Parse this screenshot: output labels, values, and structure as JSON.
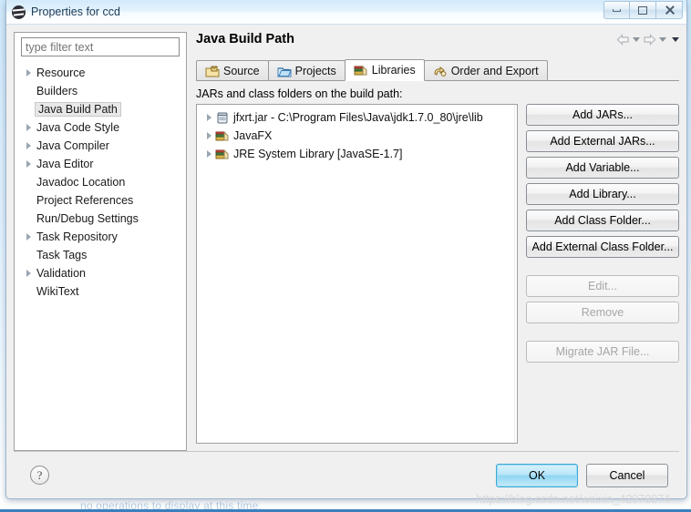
{
  "window": {
    "title": "Properties for ccd",
    "app_icon": "eclipse-icon",
    "controls": {
      "minimize": "minimize-icon",
      "maximize": "maximize-icon",
      "close": "close-icon"
    }
  },
  "sidebar": {
    "filter": {
      "value": "",
      "placeholder": "type filter text"
    },
    "items": [
      {
        "label": "Resource",
        "expandable": true,
        "selected": false
      },
      {
        "label": "Builders",
        "expandable": false,
        "selected": false
      },
      {
        "label": "Java Build Path",
        "expandable": false,
        "selected": true
      },
      {
        "label": "Java Code Style",
        "expandable": true,
        "selected": false
      },
      {
        "label": "Java Compiler",
        "expandable": true,
        "selected": false
      },
      {
        "label": "Java Editor",
        "expandable": true,
        "selected": false
      },
      {
        "label": "Javadoc Location",
        "expandable": false,
        "selected": false
      },
      {
        "label": "Project References",
        "expandable": false,
        "selected": false
      },
      {
        "label": "Run/Debug Settings",
        "expandable": false,
        "selected": false
      },
      {
        "label": "Task Repository",
        "expandable": true,
        "selected": false
      },
      {
        "label": "Task Tags",
        "expandable": false,
        "selected": false
      },
      {
        "label": "Validation",
        "expandable": true,
        "selected": false
      },
      {
        "label": "WikiText",
        "expandable": false,
        "selected": false
      }
    ]
  },
  "page": {
    "title": "Java Build Path",
    "nav": {
      "back": "back-arrow-icon",
      "back_menu": "chevron-down-icon",
      "forward": "forward-arrow-icon",
      "forward_menu": "chevron-down-icon",
      "view_menu": "view-menu-icon"
    },
    "tabs": [
      {
        "label": "Source",
        "icon": "source-folder-icon",
        "active": false
      },
      {
        "label": "Projects",
        "icon": "projects-folder-icon",
        "active": false
      },
      {
        "label": "Libraries",
        "icon": "library-books-icon",
        "active": true
      },
      {
        "label": "Order and Export",
        "icon": "order-export-icon",
        "active": false
      }
    ],
    "list_caption": "JARs and class folders on the build path:",
    "entries": [
      {
        "label": "jfxrt.jar - C:\\Program Files\\Java\\jdk1.7.0_80\\jre\\lib",
        "icon": "jar-icon",
        "expandable": true
      },
      {
        "label": "JavaFX",
        "icon": "library-books-icon",
        "expandable": true
      },
      {
        "label": "JRE System Library [JavaSE-1.7]",
        "icon": "library-books-icon",
        "expandable": true
      }
    ],
    "buttons": [
      {
        "label": "Add JARs...",
        "enabled": true
      },
      {
        "label": "Add External JARs...",
        "enabled": true
      },
      {
        "label": "Add Variable...",
        "enabled": true
      },
      {
        "label": "Add Library...",
        "enabled": true
      },
      {
        "label": "Add Class Folder...",
        "enabled": true
      },
      {
        "label": "Add External Class Folder...",
        "enabled": true
      }
    ],
    "buttons_secondary": [
      {
        "label": "Edit...",
        "enabled": false
      },
      {
        "label": "Remove",
        "enabled": false
      }
    ],
    "buttons_tertiary": [
      {
        "label": "Migrate JAR File...",
        "enabled": false
      }
    ]
  },
  "footer": {
    "help": "?",
    "ok_label": "OK",
    "cancel_label": "Cancel"
  },
  "watermark": "https://blog.csdn.net/weixin_42978874",
  "background_text": "no operations to display at this time."
}
